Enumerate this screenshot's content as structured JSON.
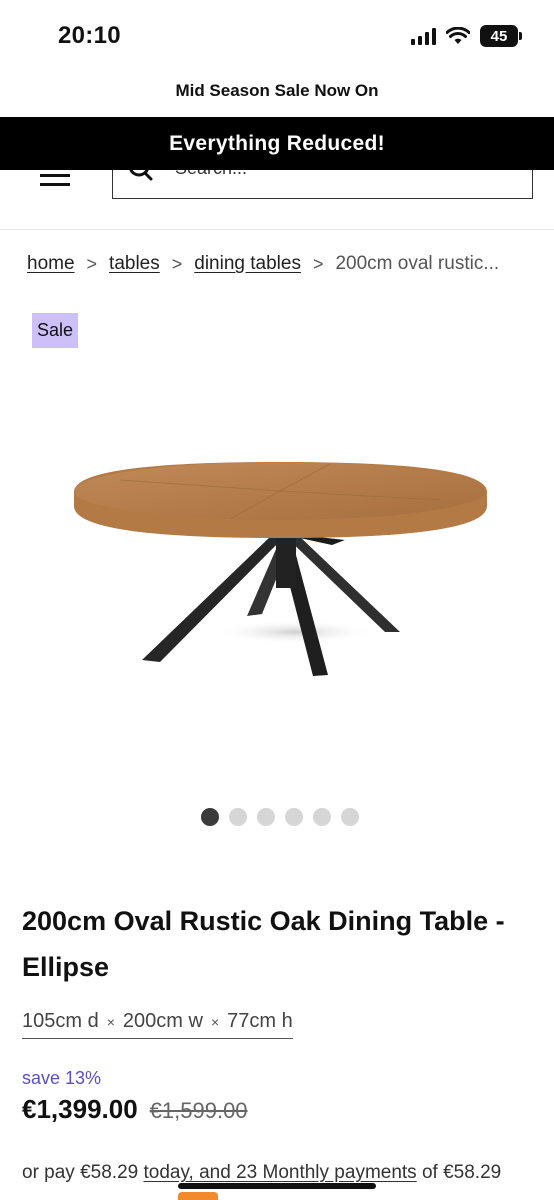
{
  "status_bar": {
    "time": "20:10",
    "battery": "45"
  },
  "promo": {
    "top_text": "Mid Season Sale Now On",
    "banner_text": "Everything Reduced!"
  },
  "search": {
    "placeholder": "Search..."
  },
  "breadcrumb": {
    "items": [
      "home",
      "tables",
      "dining tables"
    ],
    "current": "200cm oval rustic...",
    "separator": ">"
  },
  "badge": {
    "label": "Sale",
    "color": "#cdbff7"
  },
  "gallery": {
    "image_count": 6,
    "active_index": 0
  },
  "product": {
    "title": "200cm Oval Rustic Oak Dining Table - Ellipse",
    "dimensions": {
      "d": "105cm d",
      "w": "200cm w",
      "h": "77cm h",
      "sep": "×"
    },
    "save_text": "save 13%",
    "price": "€1,399.00",
    "old_price": "€1,599.00",
    "finance_prefix": "or pay €58.29 ",
    "finance_link": "today, and 23 Monthly payments",
    "finance_suffix": " of €58.29"
  },
  "colors": {
    "accent": "#5b4fc4",
    "banner_bg": "#000000"
  }
}
